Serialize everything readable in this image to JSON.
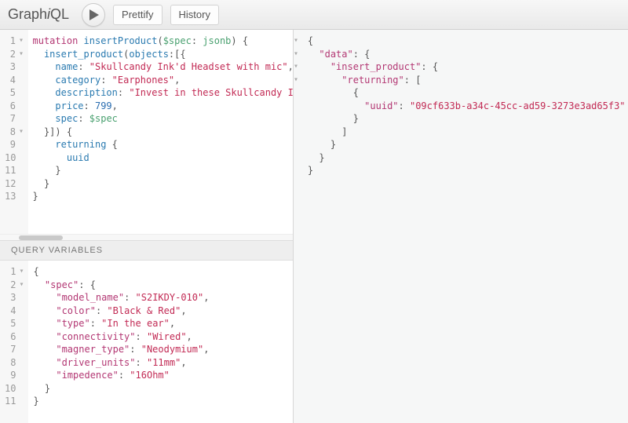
{
  "topbar": {
    "logo_pre": "Graph",
    "logo_i": "i",
    "logo_post": "QL",
    "prettify": "Prettify",
    "history": "History"
  },
  "query": {
    "line_numbers": [
      "1",
      "2",
      "3",
      "4",
      "5",
      "6",
      "7",
      "8",
      "9",
      "10",
      "11",
      "12",
      "13"
    ],
    "fold_marks": [
      "▾",
      "▾",
      "",
      "",
      "",
      "",
      "",
      "▾",
      "",
      "",
      "",
      "",
      ""
    ],
    "t": {
      "mutation": "mutation",
      "opName": "insertProduct",
      "specVar": "$spec",
      "jsonb": "jsonb",
      "insert_product": "insert_product",
      "objects": "objects",
      "name_k": "name",
      "name_v": "\"Skullcandy Ink'd Headset with mic\"",
      "category_k": "category",
      "category_v": "\"Earphones\"",
      "description_k": "description",
      "description_v": "\"Invest in these Skullcandy In",
      "price_k": "price",
      "price_v": "799",
      "spec_k": "spec",
      "returning": "returning",
      "uuid": "uuid"
    }
  },
  "vars": {
    "title": "Query Variables",
    "line_numbers": [
      "1",
      "2",
      "3",
      "4",
      "5",
      "6",
      "7",
      "8",
      "9",
      "10",
      "11"
    ],
    "fold_marks": [
      "▾",
      "▾",
      "",
      "",
      "",
      "",
      "",
      "",
      "",
      "",
      ""
    ],
    "t": {
      "spec": "\"spec\"",
      "model_name_k": "\"model_name\"",
      "model_name_v": "\"S2IKDY-010\"",
      "color_k": "\"color\"",
      "color_v": "\"Black & Red\"",
      "type_k": "\"type\"",
      "type_v": "\"In the ear\"",
      "connectivity_k": "\"connectivity\"",
      "connectivity_v": "\"Wired\"",
      "magner_type_k": "\"magner_type\"",
      "magner_type_v": "\"Neodymium\"",
      "driver_units_k": "\"driver_units\"",
      "driver_units_v": "\"11mm\"",
      "impedence_k": "\"impedence\"",
      "impedence_v": "\"16Ohm\""
    }
  },
  "result": {
    "fold_marks": [
      "▾",
      "▾",
      "▾",
      "▾",
      "",
      "",
      "",
      "",
      "",
      "",
      ""
    ],
    "t": {
      "data": "\"data\"",
      "insert_product": "\"insert_product\"",
      "returning": "\"returning\"",
      "uuid": "\"uuid\"",
      "uuid_v": "\"09cf633b-a34c-45cc-ad59-3273e3ad65f3\""
    }
  }
}
